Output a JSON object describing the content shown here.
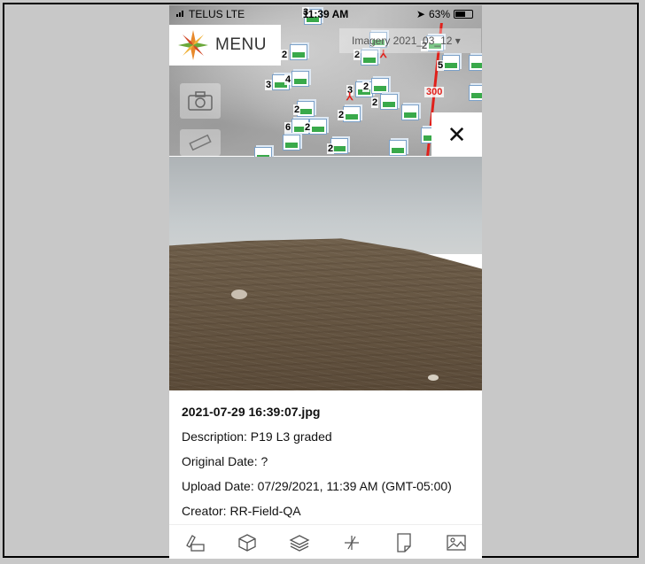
{
  "status_bar": {
    "carrier": "TELUS  LTE",
    "time": "11:39 AM",
    "battery": "63%",
    "battery_level": 0.63
  },
  "map": {
    "menu_label": "MENU",
    "imagery_label": "Imagery  2021_03_12 ▾",
    "route_label": "300",
    "marker_counts": [
      "3",
      "2",
      "2",
      "3",
      "4",
      "3",
      "2",
      "2",
      "2",
      "2",
      "6",
      "2",
      "2",
      "2",
      "5",
      "3",
      "2"
    ]
  },
  "close_label": "✕",
  "photo": {
    "filename": "2021-07-29 16:39:07.jpg",
    "description": "Description: P19 L3 graded",
    "original_date": "Original Date: ?",
    "upload_date": "Upload Date: 07/29/2021, 11:39 AM (GMT-05:00)",
    "creator": "Creator: RR-Field-QA"
  },
  "toolbar": {
    "items": [
      "ruler-tool-icon",
      "cube-icon",
      "layers-icon",
      "plus-target-icon",
      "document-icon",
      "image-icon"
    ]
  },
  "colors": {
    "route": "#e0201b",
    "marker_green": "#39a94a",
    "logo_orange": "#e8892b",
    "logo_green": "#6aa83a"
  }
}
